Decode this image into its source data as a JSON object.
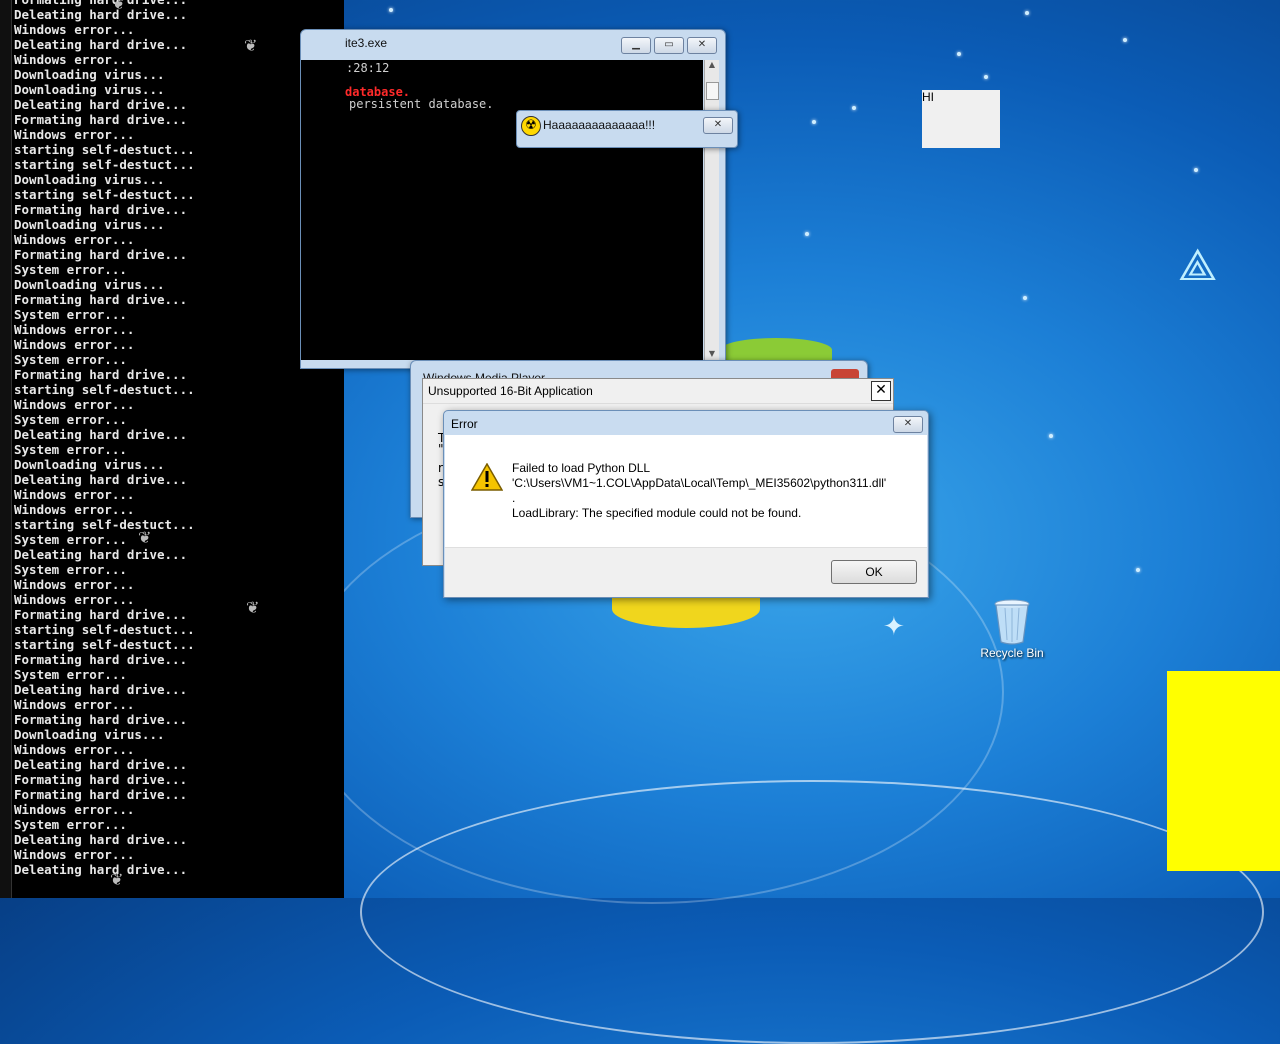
{
  "console": {
    "lines": [
      "Formating hard drive...",
      "Deleating hard drive...",
      "Windows error...",
      "Deleating hard drive...",
      "Windows error...",
      "Downloading virus...",
      "Downloading virus...",
      "Deleating hard drive...",
      "Formating hard drive...",
      "Windows error...",
      "starting self-destuct...",
      "starting self-destuct...",
      "Downloading virus...",
      "starting self-destuct...",
      "Formating hard drive...",
      "Downloading virus...",
      "Windows error...",
      "Formating hard drive...",
      "System error...",
      "Downloading virus...",
      "Formating hard drive...",
      "System error...",
      "Windows error...",
      "Windows error...",
      "System error...",
      "Formating hard drive...",
      "starting self-destuct...",
      "Windows error...",
      "System error...",
      "Deleating hard drive...",
      "System error...",
      "Downloading virus...",
      "Deleating hard drive...",
      "Windows error...",
      "Windows error...",
      "starting self-destuct...",
      "System error...",
      "Deleating hard drive...",
      "System error...",
      "Windows error...",
      "Windows error...",
      "Formating hard drive...",
      "starting self-destuct...",
      "starting self-destuct...",
      "Formating hard drive...",
      "System error...",
      "Deleating hard drive...",
      "Windows error...",
      "Formating hard drive...",
      "Downloading virus...",
      "Windows error...",
      "Deleating hard drive...",
      "Formating hard drive...",
      "Formating hard drive...",
      "Windows error...",
      "System error...",
      "Deleating hard drive...",
      "Windows error...",
      "Deleating hard drive..."
    ]
  },
  "sqlite_window": {
    "title": "ite3.exe",
    "line1": ":28:12",
    "line2": "database.",
    "line3": "persistent database."
  },
  "haaa_dialog": {
    "title": "Haaaaaaaaaaaaaa!!!"
  },
  "hi_box": {
    "text": "HI"
  },
  "wmp_window": {
    "title": "Windows Media Player"
  },
  "bit16_dialog": {
    "title": "Unsupported 16-Bit Application",
    "partial_T": "T",
    "partial_quote": "\"",
    "partial_r": "r",
    "partial_s": "s"
  },
  "error_dialog": {
    "title": "Error",
    "line1": "Failed to load Python DLL",
    "line2": "'C:\\Users\\VM1~1.COL\\AppData\\Local\\Temp\\_MEI35602\\python311.dll'",
    "line3": ".",
    "line4": "LoadLibrary: The specified module could not be found.",
    "ok_label": "OK"
  },
  "desktop": {
    "recycle_bin_label": "Recycle Bin"
  },
  "colors": {
    "yellow_box": "#ffff00",
    "console_bg": "#000000",
    "error_red": "#ff2a2a"
  }
}
